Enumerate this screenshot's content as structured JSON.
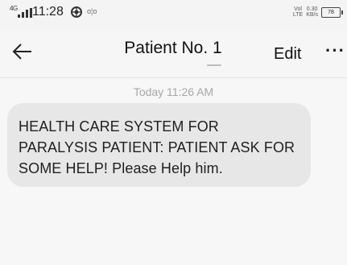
{
  "status_bar": {
    "signal_label": "4G",
    "time": "11:28",
    "app_icon": "tracker-icon",
    "small_text": "o¦o",
    "net_top": "Vol",
    "net_bottom": "LTE",
    "speed_top": "0.30",
    "speed_bottom": "KB/s",
    "battery": "78"
  },
  "header": {
    "back_icon": "back-arrow-icon",
    "title": "Patient No. 1",
    "edit_label": "Edit",
    "more_label": "···",
    "more_icon": "more-options-icon"
  },
  "conversation": {
    "timestamp": "Today 11:26 AM",
    "messages": [
      {
        "direction": "incoming",
        "text": "HEALTH CARE SYSTEM FOR PARALYSIS PATIENT: PATIENT ASK FOR SOME HELP! Please Help him."
      }
    ]
  },
  "colors": {
    "background": "#f7f7f7",
    "bubble": "#e7e7e7",
    "timestamp": "#a7a7a7",
    "text": "#1f1f1f"
  }
}
